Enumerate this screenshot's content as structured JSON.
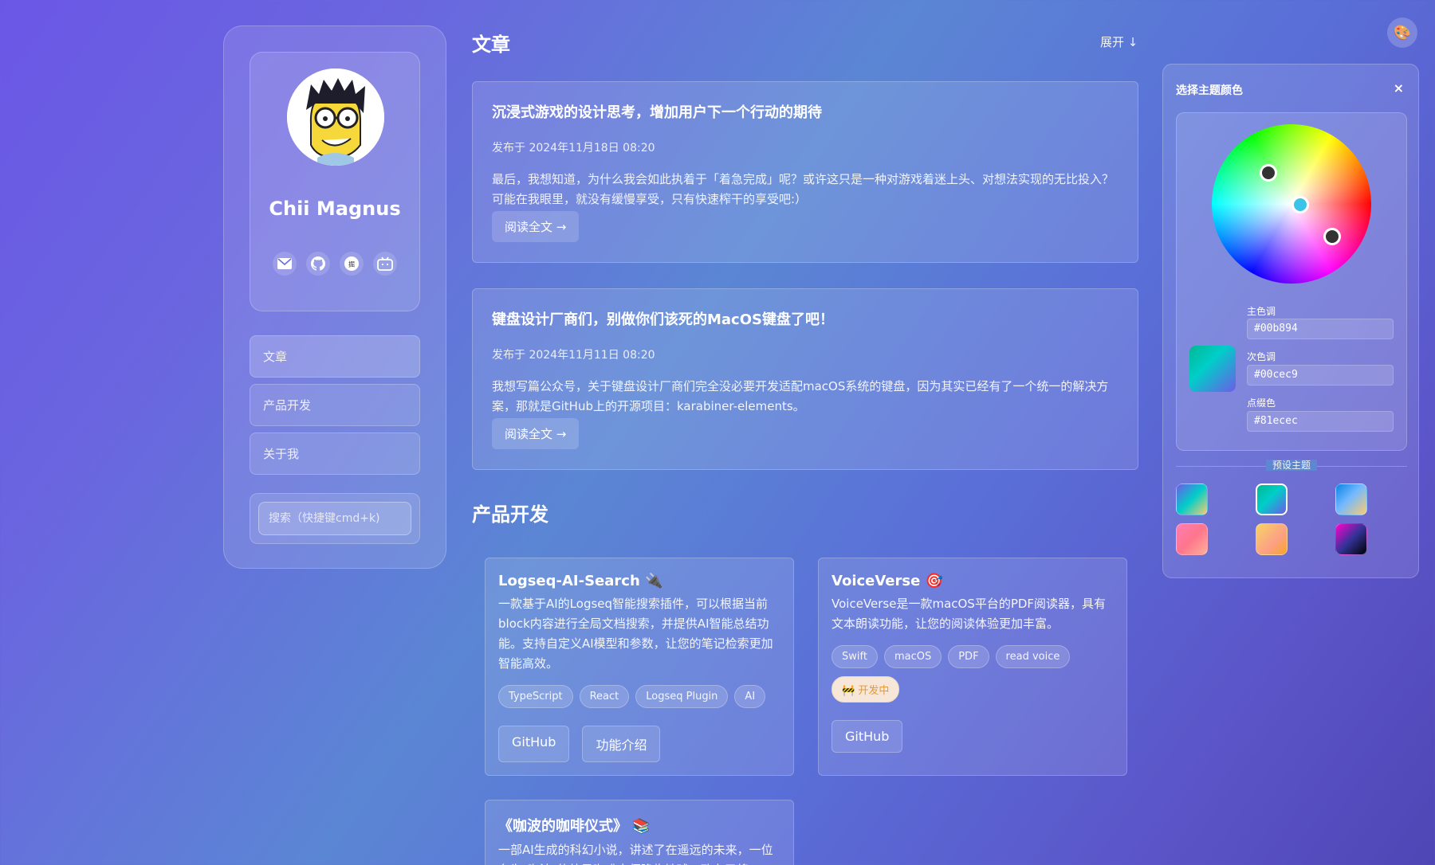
{
  "sidebar": {
    "profile_name": "Chii Magnus",
    "social_icons": [
      "mail-icon",
      "github-icon",
      "juejin-icon",
      "bilibili-icon"
    ],
    "nav": [
      {
        "label": "文章"
      },
      {
        "label": "产品开发"
      },
      {
        "label": "关于我"
      }
    ],
    "search_placeholder": "搜索（快捷键cmd+k)"
  },
  "articles_section": {
    "title": "文章",
    "expand_label": "展开 ↓",
    "items": [
      {
        "title": "沉浸式游戏的设计思考，增加用户下一个行动的期待",
        "date": "发布于 2024年11月18日 08:20",
        "excerpt": "最后，我想知道，为什么我会如此执着于「着急完成」呢？或许这只是一种对游戏着迷上头、对想法实现的无比投入？ 可能在我眼里，就没有缓慢享受，只有快速榨干的享受吧:）",
        "read_more": "阅读全文 →"
      },
      {
        "title": "键盘设计厂商们，别做你们该死的MacOS键盘了吧！",
        "date": "发布于 2024年11月11日 08:20",
        "excerpt": "我想写篇公众号，关于键盘设计厂商们完全没必要开发适配macOS系统的键盘，因为其实已经有了一个统一的解决方案，那就是GitHub上的开源项目：karabiner-elements。",
        "read_more": "阅读全文 →"
      }
    ]
  },
  "products_section": {
    "title": "产品开发",
    "items": [
      {
        "name": "Logseq-AI-Search",
        "emoji": "🔌",
        "description": "一款基于AI的Logseq智能搜索插件，可以根据当前block内容进行全局文档搜索，并提供AI智能总结功能。支持自定义AI模型和参数，让您的笔记检索更加智能高效。",
        "tags": [
          "TypeScript",
          "React",
          "Logseq Plugin",
          "AI"
        ],
        "links": [
          "GitHub",
          "功能介绍"
        ]
      },
      {
        "name": "VoiceVerse",
        "emoji": "🎯",
        "description": "VoiceVerse是一款macOS平台的PDF阅读器，具有文本朗读功能，让您的阅读体验更加丰富。",
        "tags": [
          "Swift",
          "macOS",
          "PDF",
          "read voice"
        ],
        "status": "🚧 开发中",
        "links": [
          "GitHub"
        ]
      },
      {
        "name": "《咖波的咖啡仪式》",
        "emoji": "📚",
        "description": "一部AI生成的科幻小说，讲述了在遥远的未来，一位名为\"咖波\"的外星咖啡大师降临地球，致力于将"
      }
    ]
  },
  "theme_panel": {
    "palette_icon": "palette-icon",
    "title": "选择主题颜色",
    "close_label": "×",
    "primary_label": "主色调",
    "primary_value": "#00b894",
    "secondary_label": "次色调",
    "secondary_value": "#00cec9",
    "accent_label": "点缀色",
    "accent_value": "#81ecec",
    "preset_title": "预设主题",
    "presets": [
      {
        "colors": [
          "#6c5ce7",
          "#00cec9",
          "#fdcb6e"
        ]
      },
      {
        "colors": [
          "#00b894",
          "#00cec9",
          "#6c5ce7"
        ],
        "selected": true
      },
      {
        "colors": [
          "#0984e3",
          "#74b9ff",
          "#fdcb6e"
        ]
      },
      {
        "colors": [
          "#ff7eb3",
          "#ff758c",
          "#ffb199"
        ]
      },
      {
        "colors": [
          "#f6d365",
          "#fda085",
          "#f5a623"
        ]
      },
      {
        "colors": [
          "#ff00cc",
          "#333399",
          "#000000"
        ]
      }
    ]
  }
}
